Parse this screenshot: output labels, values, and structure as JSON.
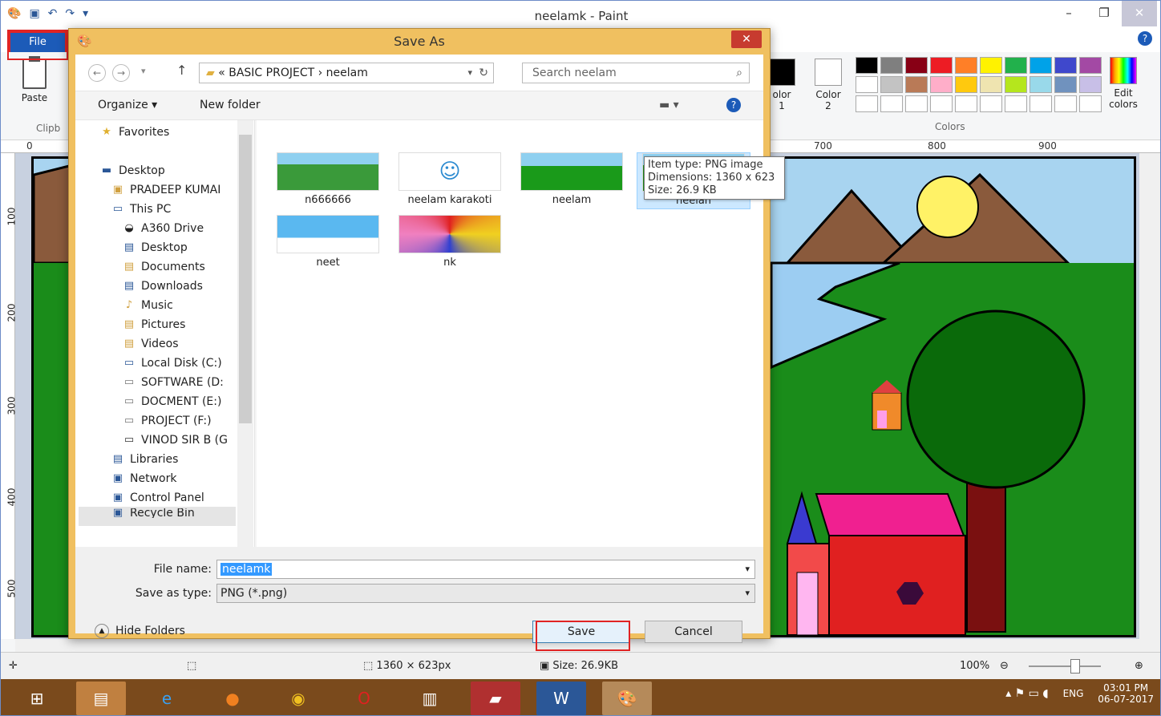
{
  "window": {
    "title": "neelamk - Paint",
    "minimize_icon": "–",
    "maximize_icon": "❐",
    "close_icon": "✕"
  },
  "ribbon": {
    "file_tab": "File",
    "paste_label": "Paste",
    "clipboard_group": "Clipb",
    "color1_label": "olor",
    "color1_num": "1",
    "color2_label": "Color",
    "color2_num": "2",
    "colors_group": "Colors",
    "edit_colors": "Edit colors",
    "help_icon": "?",
    "palette": [
      "#000000",
      "#7f7f7f",
      "#880015",
      "#ed1c24",
      "#ff7f27",
      "#fff200",
      "#22b14c",
      "#00a2e8",
      "#3f48cc",
      "#a349a4",
      "#ffffff",
      "#c3c3c3",
      "#b97a57",
      "#ffaec9",
      "#ffc90e",
      "#efe4b0",
      "#b5e61d",
      "#99d9ea",
      "#7092be",
      "#c8bfe7",
      "#ffffff",
      "#ffffff",
      "#ffffff",
      "#ffffff",
      "#ffffff",
      "#ffffff",
      "#ffffff",
      "#ffffff",
      "#ffffff",
      "#ffffff"
    ]
  },
  "ruler": {
    "h": [
      "0",
      "700",
      "800",
      "900"
    ],
    "v": [
      "100",
      "200",
      "300",
      "400",
      "500"
    ]
  },
  "dialog": {
    "title": "Save As",
    "address": "«  BASIC PROJECT  ›  neelam",
    "search_placeholder": "Search neelam",
    "organize": "Organize ▾",
    "new_folder": "New folder",
    "nav_items": [
      {
        "label": "Favorites",
        "icon": "★"
      },
      {
        "label": "Desktop",
        "icon": "▬"
      },
      {
        "label": "PRADEEP KUMAI",
        "icon": "▣"
      },
      {
        "label": "This PC",
        "icon": "▭"
      },
      {
        "label": "A360 Drive",
        "icon": "◒"
      },
      {
        "label": "Desktop",
        "icon": "▤"
      },
      {
        "label": "Documents",
        "icon": "▤"
      },
      {
        "label": "Downloads",
        "icon": "▤"
      },
      {
        "label": "Music",
        "icon": "♪"
      },
      {
        "label": "Pictures",
        "icon": "▤"
      },
      {
        "label": "Videos",
        "icon": "▤"
      },
      {
        "label": "Local Disk (C:)",
        "icon": "▭"
      },
      {
        "label": "SOFTWARE (D:",
        "icon": "▭"
      },
      {
        "label": "DOCMENT (E:)",
        "icon": "▭"
      },
      {
        "label": "PROJECT (F:)",
        "icon": "▭"
      },
      {
        "label": "VINOD SIR B (G",
        "icon": "▭"
      },
      {
        "label": "Libraries",
        "icon": "▤"
      },
      {
        "label": "Network",
        "icon": "▣"
      },
      {
        "label": "Control Panel",
        "icon": "▣"
      },
      {
        "label": "Recycle Bin",
        "icon": "▣"
      }
    ],
    "files": [
      "n666666",
      "neelam karakoti",
      "neelam",
      "neelan",
      "neet",
      "nk"
    ],
    "tooltip": {
      "type": "Item type: PNG image",
      "dims": "Dimensions: 1360 x 623",
      "size": "Size: 26.9 KB"
    },
    "file_name_label": "File name:",
    "file_name_value": "neelamk",
    "save_type_label": "Save as type:",
    "save_type_value": "PNG (*.png)",
    "save_button": "Save",
    "cancel_button": "Cancel",
    "hide_folders": "Hide Folders"
  },
  "status": {
    "dims": "1360 × 623px",
    "size": "Size: 26.9KB",
    "zoom": "100%"
  },
  "tray": {
    "lang": "ENG",
    "time": "03:01 PM",
    "date": "06-07-2017"
  }
}
